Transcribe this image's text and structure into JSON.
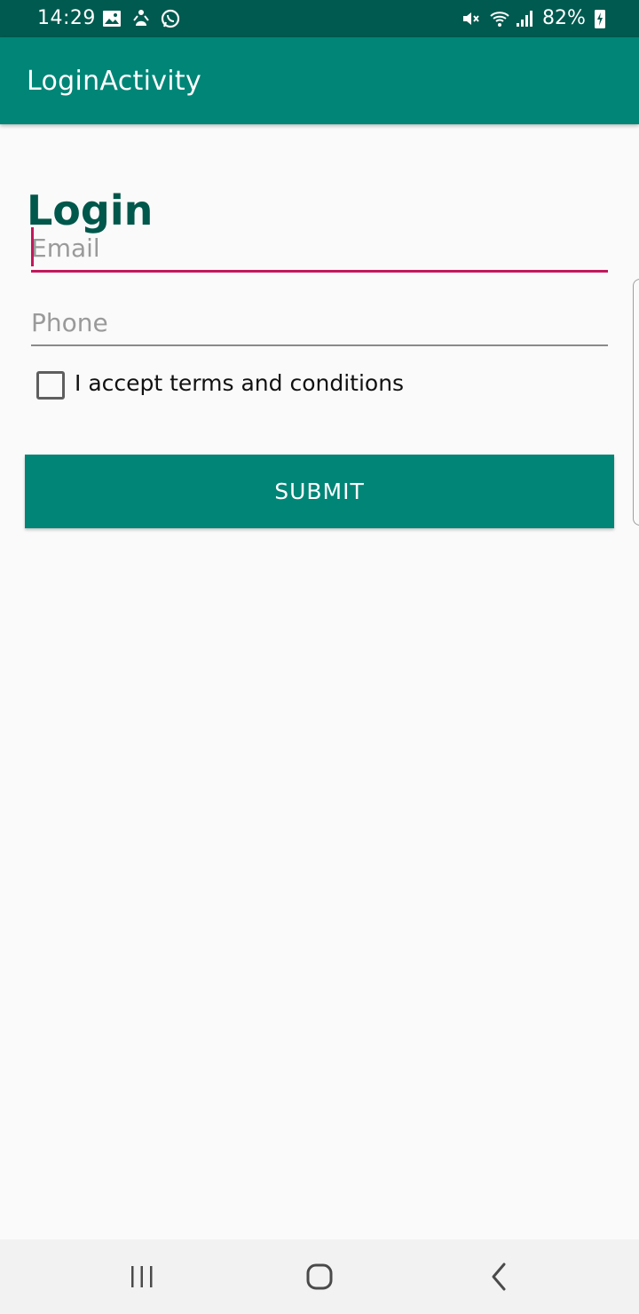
{
  "status_bar": {
    "time": "14:29",
    "battery": "82%",
    "icons": [
      "image-icon",
      "person-notification-icon",
      "whatsapp-icon",
      "mute-icon",
      "wifi-icon",
      "signal-icon",
      "battery-charging-icon"
    ]
  },
  "app_bar": {
    "title": "LoginActivity"
  },
  "form": {
    "heading": "Login",
    "email_placeholder": "Email",
    "phone_placeholder": "Phone",
    "terms_label": "I accept terms and conditions",
    "terms_checked": false,
    "submit_label": "SUBMIT"
  },
  "colors": {
    "status_bar": "#005a4f",
    "primary": "#008577",
    "primary_dark": "#00574b",
    "accent": "#c2185b",
    "background": "#fafafa"
  },
  "navigation": {
    "buttons": [
      "recent-apps-icon",
      "home-icon",
      "back-icon"
    ]
  }
}
